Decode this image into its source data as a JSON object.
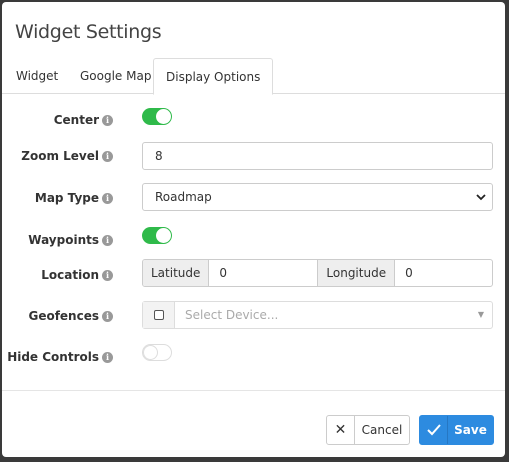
{
  "modal": {
    "title": "Widget Settings"
  },
  "tabs": [
    {
      "label": "Widget",
      "active": false
    },
    {
      "label": "Google Map",
      "active": false
    },
    {
      "label": "Display Options",
      "active": true
    }
  ],
  "fields": {
    "center": {
      "label": "Center",
      "value": true
    },
    "zoom_level": {
      "label": "Zoom Level",
      "value": "8"
    },
    "map_type": {
      "label": "Map Type",
      "value": "Roadmap"
    },
    "waypoints": {
      "label": "Waypoints",
      "value": true
    },
    "location": {
      "label": "Location",
      "latitude_label": "Latitude",
      "latitude_value": "0",
      "longitude_label": "Longitude",
      "longitude_value": "0"
    },
    "geofences": {
      "label": "Geofences",
      "placeholder": "Select Device...",
      "checked": false
    },
    "hide_controls": {
      "label": "Hide Controls",
      "value": false
    }
  },
  "buttons": {
    "cancel": "Cancel",
    "save": "Save"
  },
  "colors": {
    "toggle_on": "#2fba4a",
    "primary": "#2d8be0"
  },
  "icons": {
    "info": "info-icon",
    "close": "close-icon",
    "check": "check-icon",
    "chevron": "chevron-down-icon"
  }
}
